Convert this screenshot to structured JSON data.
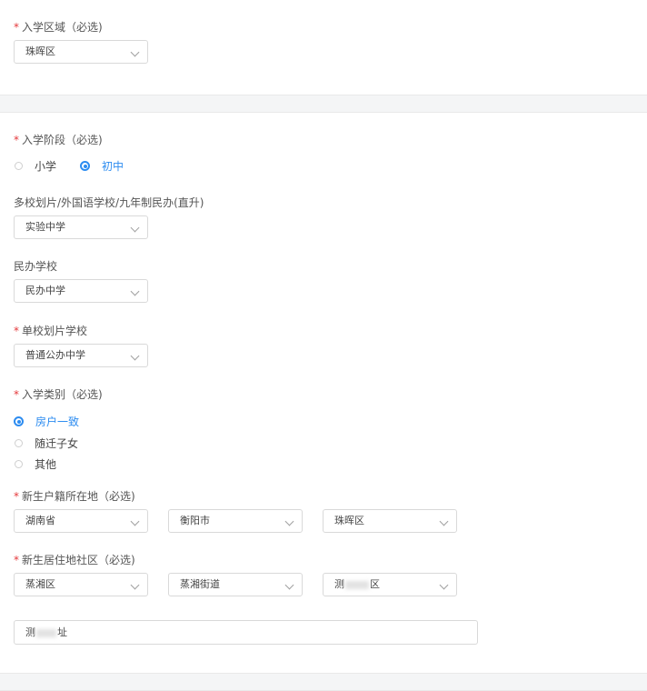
{
  "section1": {
    "enroll_area_label": "入学区域（必选)",
    "enroll_area_value": "珠晖区"
  },
  "section2": {
    "stage_label": "入学阶段（必选)",
    "stage_options": [
      "小学",
      "初中"
    ],
    "stage_selected": "初中",
    "multi_school_label": "多校划片/外国语学校/九年制民办(直升)",
    "multi_school_value": "实验中学",
    "private_school_label": "民办学校",
    "private_school_value": "民办中学",
    "single_school_label": "单校划片学校",
    "single_school_value": "普通公办中学",
    "category_label": "入学类别（必选)",
    "category_options": [
      "房户一致",
      "随迁子女",
      "其他"
    ],
    "category_selected": "房户一致",
    "hukou_label": "新生户籍所在地（必选)",
    "hukou_province": "湖南省",
    "hukou_city": "衡阳市",
    "hukou_district": "珠晖区",
    "residence_label": "新生居住地社区（必选)",
    "residence_district": "蒸湘区",
    "residence_street": "蒸湘街道",
    "residence_community_prefix": "测",
    "residence_community_suffix": "区",
    "address_prefix": "测",
    "address_suffix": "址"
  },
  "colors": {
    "required_star": "#e4393c",
    "accent": "#2d8cf0",
    "divider_bg": "#f4f5f6"
  },
  "icons": {
    "dropdown": "chevron-down-icon",
    "radio_checked": "radio-checked-icon",
    "radio_unchecked": "radio-unchecked-icon"
  }
}
